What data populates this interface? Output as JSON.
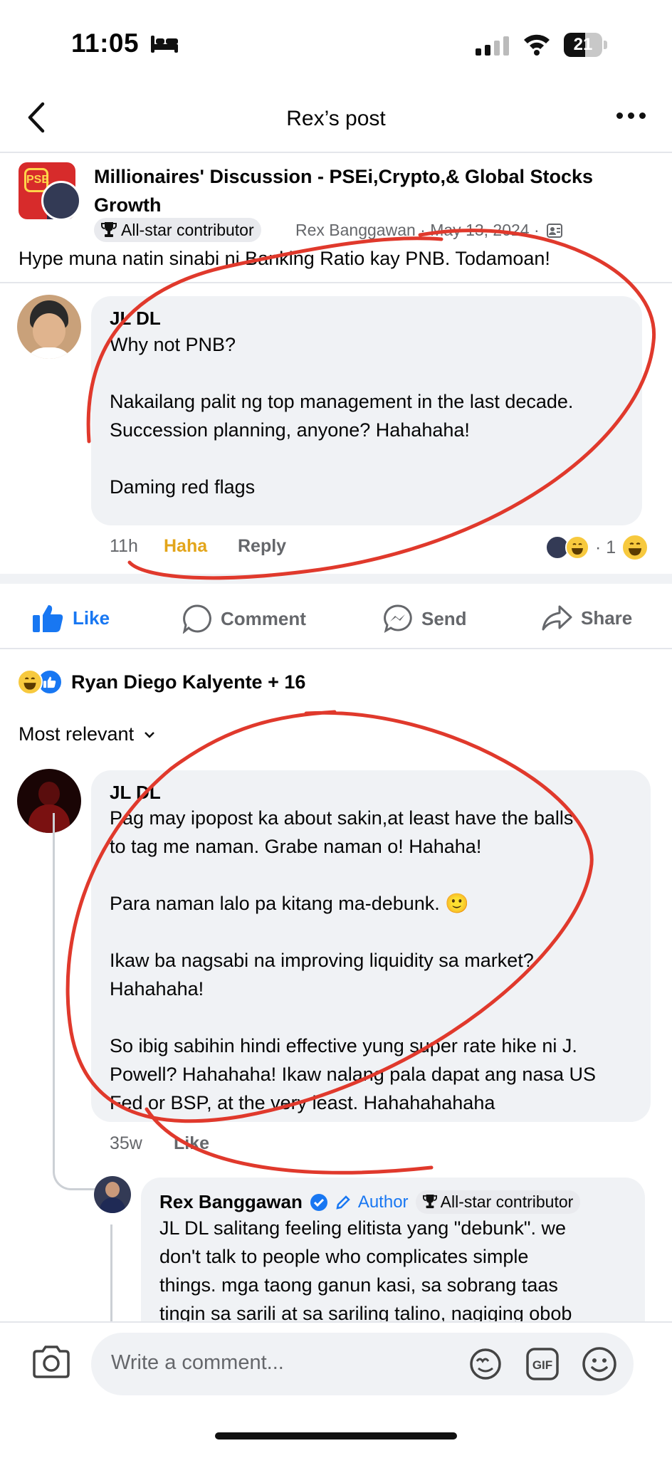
{
  "status_bar": {
    "time": "11:05",
    "battery": "21"
  },
  "header": {
    "title": "Rex’s post"
  },
  "post": {
    "group_name": "Millionaires' Discussion - PSEi,Crypto,& Global Stocks Growth",
    "badge": "All-star contributor",
    "meta": "Rex Banggawan · May 13, 2024 ·",
    "text": "Hype muna natin sinabi ni Banking Ratio kay PNB. Todamoan!",
    "group_logo_text": "PSE"
  },
  "first_comment": {
    "author": "JL DL",
    "text": "Why not PNB?\n\nNakailang palit ng top management in the last decade.\nSuccession planning, anyone? Hahahaha!\n\nDaming red flags",
    "time": "11h",
    "reaction_label": "Haha",
    "reply_label": "Reply",
    "reaction_count": "· 1"
  },
  "actions": {
    "like": "Like",
    "comment": "Comment",
    "send": "Send",
    "share": "Share"
  },
  "reactions_summary": "Ryan Diego Kalyente + 16",
  "sort_label": "Most relevant",
  "second_comment": {
    "author": "JL DL",
    "text": "Pag may ipopost ka about sakin,at least have the balls\nto tag me naman. Grabe naman o! Hahaha!\n\nPara naman lalo pa kitang ma-debunk. 🙂\n\nIkaw ba nagsabi na improving liquidity sa market?\nHahahaha!\n\nSo ibig sabihin hindi effective yung super rate hike ni J.\nPowell? Hahahaha! Ikaw nalang pala dapat ang nasa US\nFed or BSP, at the very least. Hahahahahaha",
    "time": "35w",
    "like_label": "Like"
  },
  "reply": {
    "author": "Rex Banggawan",
    "author_tag": "Author",
    "badge": "All-star contributor",
    "text": "JL DL salitang feeling elitista yang \"debunk\". we\ndon't talk to people who complicates simple\nthings. mga taong ganun kasi, sa sobrang taas\ntingin sa sarili at sa sariling talino, nagiging obob"
  },
  "composer": {
    "placeholder": "Write a comment..."
  },
  "colors": {
    "accent": "#1877f2",
    "haha": "#e3a51a",
    "annotation": "#e0392c"
  }
}
